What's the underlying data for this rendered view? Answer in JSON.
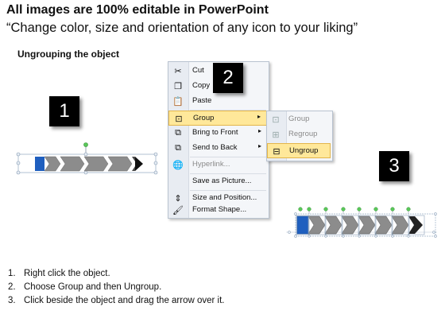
{
  "header": {
    "title": "All images are 100% editable in PowerPoint",
    "subtitle": "“Change color, size and orientation of any icon to your liking”",
    "section": "Ungrouping the object"
  },
  "badges": [
    "1",
    "2",
    "3"
  ],
  "context_menu": {
    "items": [
      {
        "label": "Cut",
        "icon": "scissors-icon"
      },
      {
        "label": "Copy",
        "icon": "copy-icon"
      },
      {
        "label": "Paste",
        "icon": "paste-icon"
      },
      {
        "label": "Group",
        "icon": "group-icon",
        "highlighted": true,
        "submenu_arrow": "▸"
      },
      {
        "label": "Bring to Front",
        "icon": "bring-front-icon",
        "submenu_arrow": "▸"
      },
      {
        "label": "Send to Back",
        "icon": "send-back-icon",
        "submenu_arrow": "▸"
      },
      {
        "label": "Hyperlink...",
        "icon": "hyperlink-icon",
        "disabled": true
      },
      {
        "label": "Save as Picture...",
        "icon": ""
      },
      {
        "label": "Size and Position...",
        "icon": "size-position-icon"
      },
      {
        "label": "Format Shape...",
        "icon": "format-shape-icon"
      }
    ]
  },
  "group_submenu": {
    "items": [
      {
        "label": "Group",
        "icon": "group-icon",
        "disabled": true
      },
      {
        "label": "Regroup",
        "icon": "regroup-icon",
        "disabled": true
      },
      {
        "label": "Ungroup",
        "icon": "ungroup-icon",
        "highlighted": true
      }
    ]
  },
  "instructions": [
    {
      "num": "1.",
      "text": "Right click the object."
    },
    {
      "num": "2.",
      "text": "Choose Group and then Ungroup."
    },
    {
      "num": "3.",
      "text": "Click beside the object and drag the arrow over it."
    }
  ],
  "colors": {
    "accent_blue": "#1f5fbf",
    "chevron_grey": "#8c8c8c",
    "chevron_dark": "#4a4a4a",
    "menu_highlight": "#ffe89a",
    "handle_green": "#5ac85a"
  }
}
